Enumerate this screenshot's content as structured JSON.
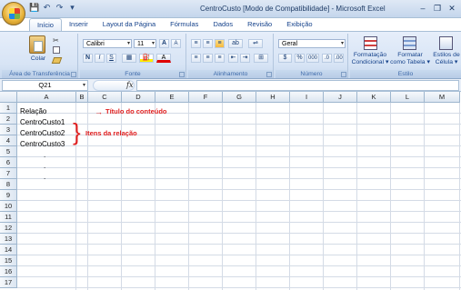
{
  "window": {
    "title": "CentroCusto  [Modo de Compatibilidade] - Microsoft Excel",
    "minimize": "–",
    "restore": "❐",
    "close": "✕"
  },
  "qat": {
    "save": "💾",
    "undo": "↶",
    "redo": "↷",
    "customize": "▾"
  },
  "tabs": [
    "Início",
    "Inserir",
    "Layout da Página",
    "Fórmulas",
    "Dados",
    "Revisão",
    "Exibição"
  ],
  "ribbon": {
    "clipboard": {
      "paste": "Colar",
      "label": "Área de Transferência"
    },
    "font": {
      "name": "Calibri",
      "size": "11",
      "grow": "A",
      "shrink": "A",
      "bold": "N",
      "italic": "I",
      "underline": "S",
      "label": "Fonte"
    },
    "alignment": {
      "label": "Alinhamento"
    },
    "number": {
      "format": "Geral",
      "percent": "%",
      "thousands": "000",
      "label": "Número"
    },
    "styles": {
      "conditional": "Formatação\nCondicional ▾",
      "conditional_1": "Formatação",
      "conditional_2": "Condicional ▾",
      "table_1": "Formatar",
      "table_2": "como Tabela ▾",
      "cell_1": "Estilos de",
      "cell_2": "Célula ▾",
      "label": "Estilo"
    }
  },
  "formula_bar": {
    "name_box": "Q21",
    "fx": "fx",
    "value": ""
  },
  "columns": [
    "A",
    "B",
    "C",
    "D",
    "E",
    "F",
    "G",
    "H",
    "I",
    "J",
    "K",
    "L",
    "M"
  ],
  "rows": [
    "1",
    "2",
    "3",
    "4",
    "5",
    "6",
    "7",
    "8",
    "9",
    "10",
    "11",
    "12",
    "13",
    "14",
    "15",
    "16",
    "17"
  ],
  "cells": {
    "A1": "Relação",
    "A2": "CentroCusto1",
    "A3": "CentroCusto2",
    "A4": "CentroCusto3",
    "A5": ".",
    "A6": ".",
    "A7": "."
  },
  "annotations": {
    "title_note": "Título do conteúdo",
    "items_note": "Itens da relação",
    "arrow": "→",
    "brace": "}"
  },
  "colors": {
    "annotation": "#e02020",
    "ribbon": "#d7e4f5",
    "grid_line": "#d4dbe6"
  }
}
